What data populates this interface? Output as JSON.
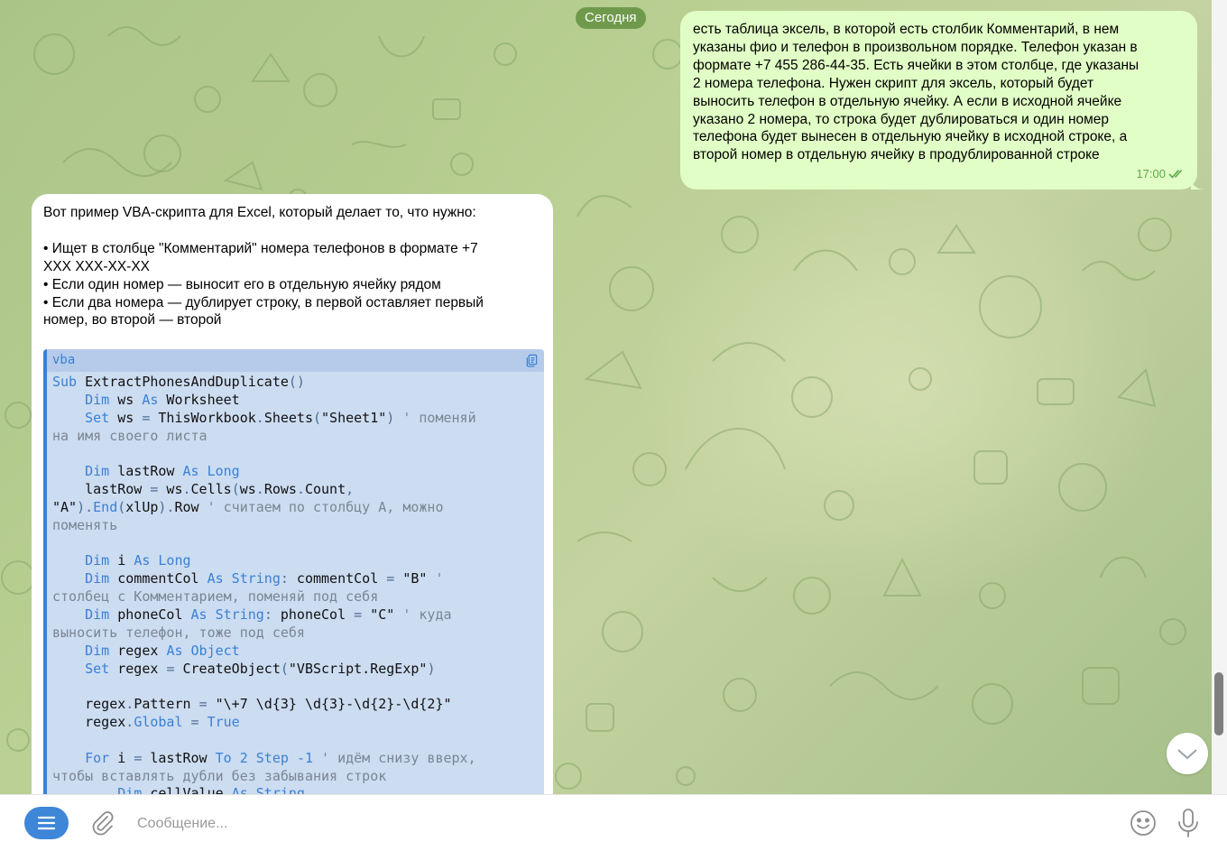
{
  "chat": {
    "date_label": "Сегодня",
    "outgoing": {
      "text": "есть таблица эксель, в которой есть столбик Комментарий, в нем\nуказаны фио и телефон в произвольном порядке. Телефон указан в\nформате +7 455 286-44-35. Есть ячейки в этом столбце, где указаны\n2 номера телефона. Нужен скрипт для эксель, который будет\nвыносить телефон в отдельную ячейку. А если в исходной ячейке\nуказано 2 номера, то строка будет дублироваться и один номер\nтелефона будет вынесен в отдельную ячейку в исходной строке, а\nвторой номер в отдельную ячейку в продублированной строке",
      "time": "17:00"
    },
    "incoming": {
      "text": "Вот пример VBA-скрипта для Excel, который делает то, что нужно:\n\n• Ищет в столбце \"Комментарий\" номера телефонов в формате +7\nXXX XXX-XX-XX\n• Если один номер — выносит его в отдельную ячейку рядом\n• Если два номера — дублирует строку, в первой оставляет первый\nномер, во второй — второй",
      "code_lang": "vba"
    }
  },
  "composer": {
    "placeholder": "Сообщение..."
  },
  "icons": [
    "menu-icon",
    "paperclip-icon",
    "emoji-icon",
    "microphone-icon",
    "copy-icon",
    "chevron-down-icon",
    "double-check-icon"
  ],
  "colors": {
    "outgoing_bubble": "#e1fec6",
    "code_bg": "#ccdcf1",
    "accent": "#3d86d8",
    "date_pill": "#6f9a4c"
  }
}
